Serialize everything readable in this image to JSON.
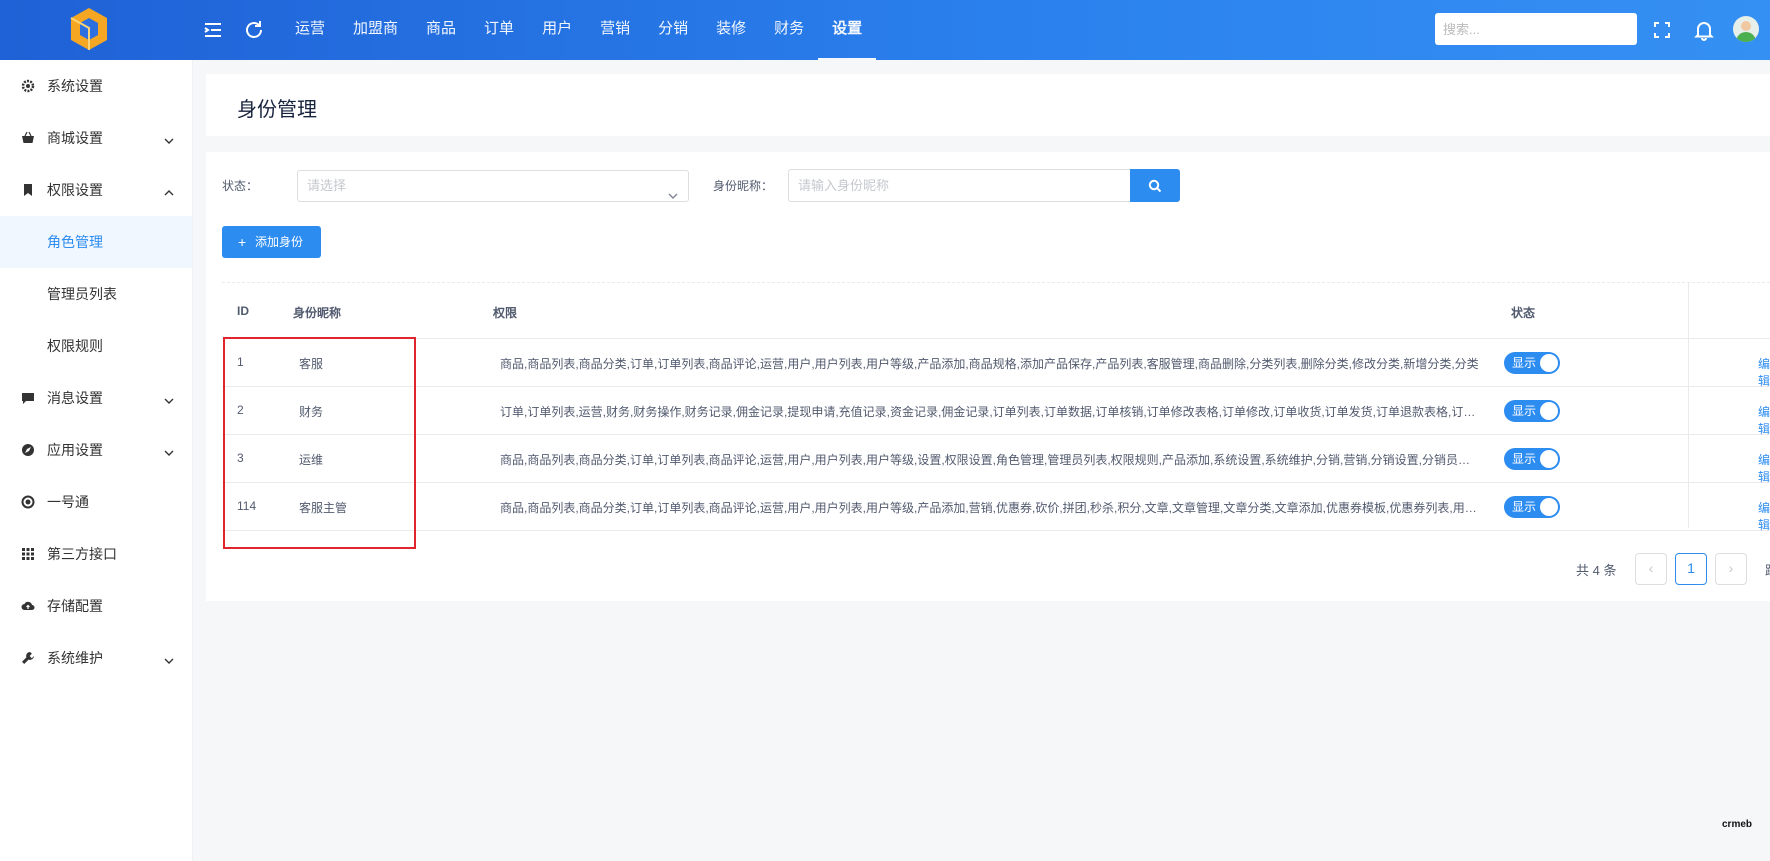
{
  "header": {
    "nav_items": [
      "运营",
      "加盟商",
      "商品",
      "订单",
      "用户",
      "营销",
      "分销",
      "装修",
      "财务",
      "设置"
    ],
    "active_nav": "设置",
    "search_placeholder": "搜索..."
  },
  "sidebar": {
    "items": [
      {
        "label": "系统设置",
        "icon": "gear-icon",
        "expandable": false
      },
      {
        "label": "商城设置",
        "icon": "basket-icon",
        "expandable": true,
        "expanded": false
      },
      {
        "label": "权限设置",
        "icon": "bookmark-icon",
        "expandable": true,
        "expanded": true
      },
      {
        "label": "角色管理",
        "sub": true,
        "active": true
      },
      {
        "label": "管理员列表",
        "sub": true
      },
      {
        "label": "权限规则",
        "sub": true
      },
      {
        "label": "消息设置",
        "icon": "message-icon",
        "expandable": true,
        "expanded": false
      },
      {
        "label": "应用设置",
        "icon": "compass-icon",
        "expandable": true,
        "expanded": false
      },
      {
        "label": "一号通",
        "icon": "circle-icon",
        "expandable": false
      },
      {
        "label": "第三方接口",
        "icon": "grid-icon",
        "expandable": false
      },
      {
        "label": "存储配置",
        "icon": "cloud-upload-icon",
        "expandable": false
      },
      {
        "label": "系统维护",
        "icon": "wrench-icon",
        "expandable": true,
        "expanded": false
      }
    ]
  },
  "page": {
    "title": "身份管理"
  },
  "filters": {
    "status_label": "状态：",
    "status_placeholder": "请选择",
    "name_label": "身份昵称：",
    "name_placeholder": "请输入身份昵称",
    "add_button": "添加身份"
  },
  "table": {
    "headers": {
      "id": "ID",
      "name": "身份昵称",
      "permissions": "权限",
      "status": "状态"
    },
    "rows": [
      {
        "id": "1",
        "name": "客服",
        "permissions": "商品,商品列表,商品分类,订单,订单列表,商品评论,运营,用户,用户列表,用户等级,产品添加,商品规格,添加产品保存,产品列表,客服管理,商品删除,分类列表,删除分类,修改分类,新增分类,分类",
        "status": "显示",
        "action": "编辑"
      },
      {
        "id": "2",
        "name": "财务",
        "permissions": "订单,订单列表,运营,财务,财务操作,财务记录,佣金记录,提现申请,充值记录,资金记录,佣金记录,订单列表,订单数据,订单核销,订单修改表格,订单修改,订单收货,订单发货,订单退款表格,订单退款",
        "status": "显示",
        "action": "编辑"
      },
      {
        "id": "3",
        "name": "运维",
        "permissions": "商品,商品列表,商品分类,订单,订单列表,商品评论,运营,用户,用户列表,用户等级,设置,权限设置,角色管理,管理员列表,权限规则,产品添加,系统设置,系统维护,分销,营销,分销设置,分销员管理",
        "status": "显示",
        "action": "编辑"
      },
      {
        "id": "114",
        "name": "客服主管",
        "permissions": "商品,商品列表,商品分类,订单,订单列表,商品评论,运营,用户,用户列表,用户等级,产品添加,营销,优惠券,砍价,拼团,秒杀,积分,文章,文章管理,文章分类,文章添加,优惠券模板,优惠券列表,用户管理",
        "status": "显示",
        "action": "编辑"
      }
    ]
  },
  "pagination": {
    "total_text": "共 4 条",
    "current_page": "1",
    "prev": "‹",
    "next": "›",
    "trail": "跳"
  },
  "watermark": "crmeb",
  "colors": {
    "primary": "#2d8cf0",
    "header_start": "#1f61d6",
    "header_end": "#3590f3",
    "highlight_border": "#e0262c",
    "logo": "#f5a623"
  }
}
